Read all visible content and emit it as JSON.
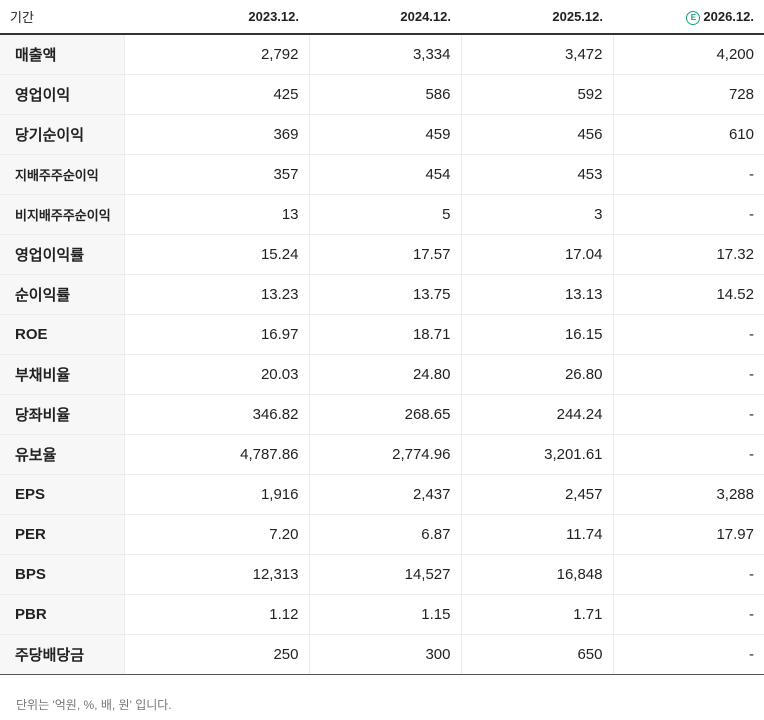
{
  "header": {
    "period_label": "기간",
    "years": [
      "2023.12.",
      "2024.12.",
      "2025.12.",
      "2026.12."
    ],
    "estimate_badge": "E"
  },
  "rows": [
    {
      "label": "매출액",
      "values": [
        "2,792",
        "3,334",
        "3,472",
        "4,200"
      ]
    },
    {
      "label": "영업이익",
      "values": [
        "425",
        "586",
        "592",
        "728"
      ]
    },
    {
      "label": "당기순이익",
      "values": [
        "369",
        "459",
        "456",
        "610"
      ]
    },
    {
      "label": "지배주주순이익",
      "values": [
        "357",
        "454",
        "453",
        "-"
      ]
    },
    {
      "label": "비지배주주순이익",
      "values": [
        "13",
        "5",
        "3",
        "-"
      ]
    },
    {
      "label": "영업이익률",
      "values": [
        "15.24",
        "17.57",
        "17.04",
        "17.32"
      ]
    },
    {
      "label": "순이익률",
      "values": [
        "13.23",
        "13.75",
        "13.13",
        "14.52"
      ]
    },
    {
      "label": "ROE",
      "values": [
        "16.97",
        "18.71",
        "16.15",
        "-"
      ]
    },
    {
      "label": "부채비율",
      "values": [
        "20.03",
        "24.80",
        "26.80",
        "-"
      ]
    },
    {
      "label": "당좌비율",
      "values": [
        "346.82",
        "268.65",
        "244.24",
        "-"
      ]
    },
    {
      "label": "유보율",
      "values": [
        "4,787.86",
        "2,774.96",
        "3,201.61",
        "-"
      ]
    },
    {
      "label": "EPS",
      "values": [
        "1,916",
        "2,437",
        "2,457",
        "3,288"
      ]
    },
    {
      "label": "PER",
      "values": [
        "7.20",
        "6.87",
        "11.74",
        "17.97"
      ]
    },
    {
      "label": "BPS",
      "values": [
        "12,313",
        "14,527",
        "16,848",
        "-"
      ]
    },
    {
      "label": "PBR",
      "values": [
        "1.12",
        "1.15",
        "1.71",
        "-"
      ]
    },
    {
      "label": "주당배당금",
      "values": [
        "250",
        "300",
        "650",
        "-"
      ]
    }
  ],
  "footer_note": "단위는 '억원, %, 배, 원' 입니다.",
  "colors": {
    "estimate_badge": "#17a085",
    "label_bg": "#f7f7f7"
  }
}
